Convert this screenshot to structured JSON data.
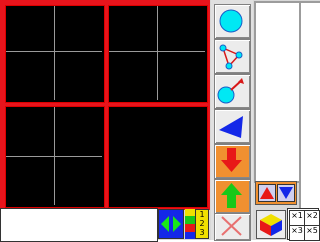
{
  "levels": {
    "items": [
      "1",
      "2",
      "3"
    ]
  },
  "zoom": {
    "items": [
      "×1",
      "×2",
      "×3",
      "×5"
    ]
  },
  "status": {
    "text": ""
  },
  "colors": {
    "grid_border": "#e8141c",
    "tile_bg": "#000000",
    "accent_cyan": "#00e8f4",
    "accent_blue": "#1428e8",
    "accent_orange": "#f09030",
    "accent_red": "#e81818",
    "accent_green": "#18c818"
  },
  "icons": {
    "tool1": "circle-icon",
    "tool2": "connect-nodes-icon",
    "tool3": "vector-icon",
    "tool4": "triangle-icon",
    "tool5": "import-down-icon",
    "tool6": "export-up-icon",
    "tool7": "delete-x-icon",
    "nav_left_right": "left-right-arrows-icon",
    "nav_up": "up-arrow-icon",
    "nav_down": "down-arrow-icon",
    "cube": "color-cube-icon"
  }
}
